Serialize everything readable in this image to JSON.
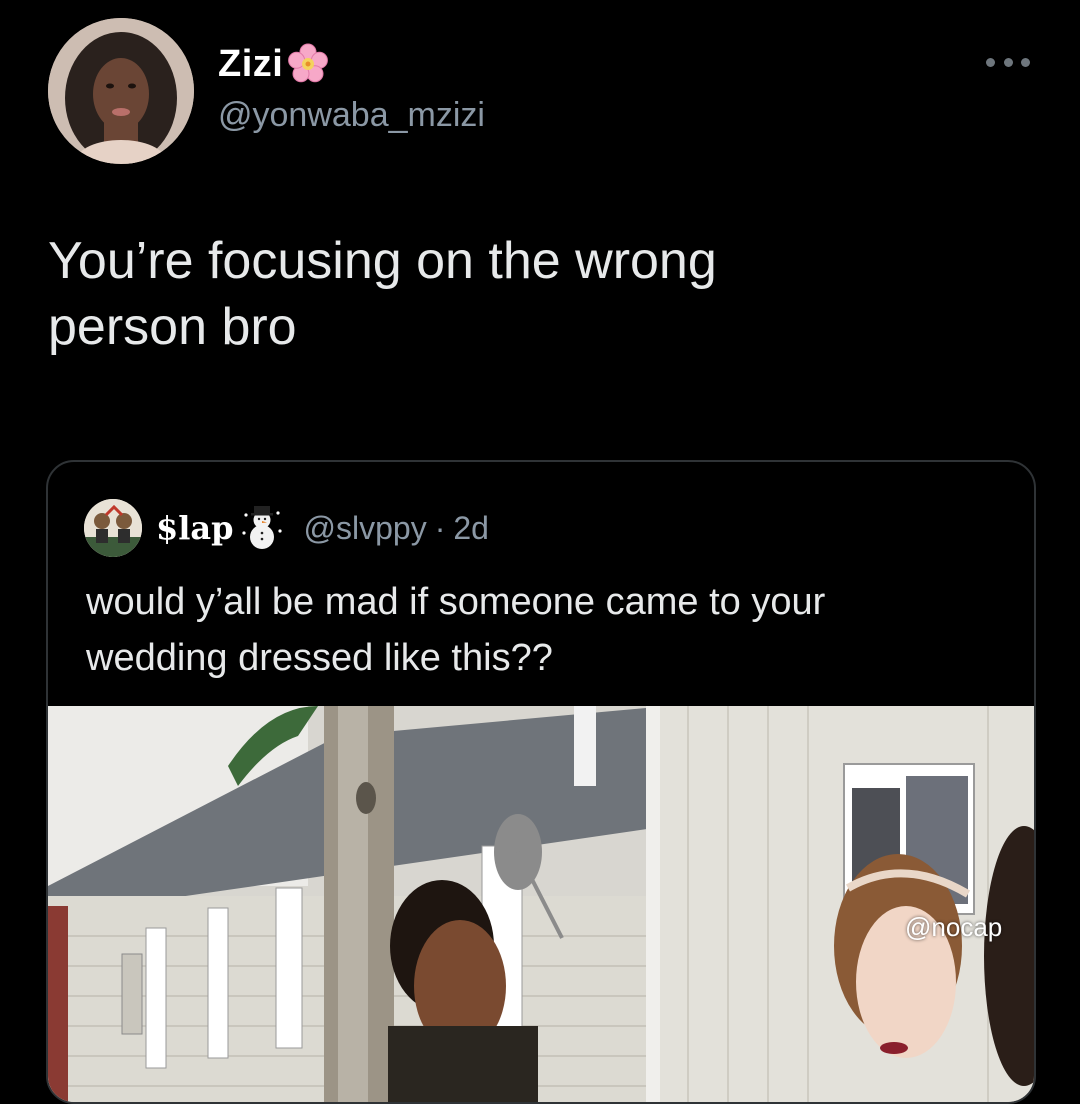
{
  "tweet": {
    "display_name": "Zizi",
    "name_emoji": "cherry-blossom-icon",
    "handle": "@yonwaba_mzizi",
    "text": "You’re focusing on the wrong\nperson bro",
    "menu_icon": "more-horizontal-icon"
  },
  "quoted_tweet": {
    "display_name": "$lap",
    "name_emoji": "snowman-icon",
    "handle": "@slvppy",
    "separator": "·",
    "time": "2d",
    "text": "would y’all be mad if someone came to your\nwedding dressed like this??",
    "media_description_icon": "photo-icon"
  },
  "watermark": "@nocap",
  "colors": {
    "background": "#000000",
    "text_primary": "#e7e9ea",
    "text_secondary": "#8b98a5",
    "border": "#2f3336"
  }
}
